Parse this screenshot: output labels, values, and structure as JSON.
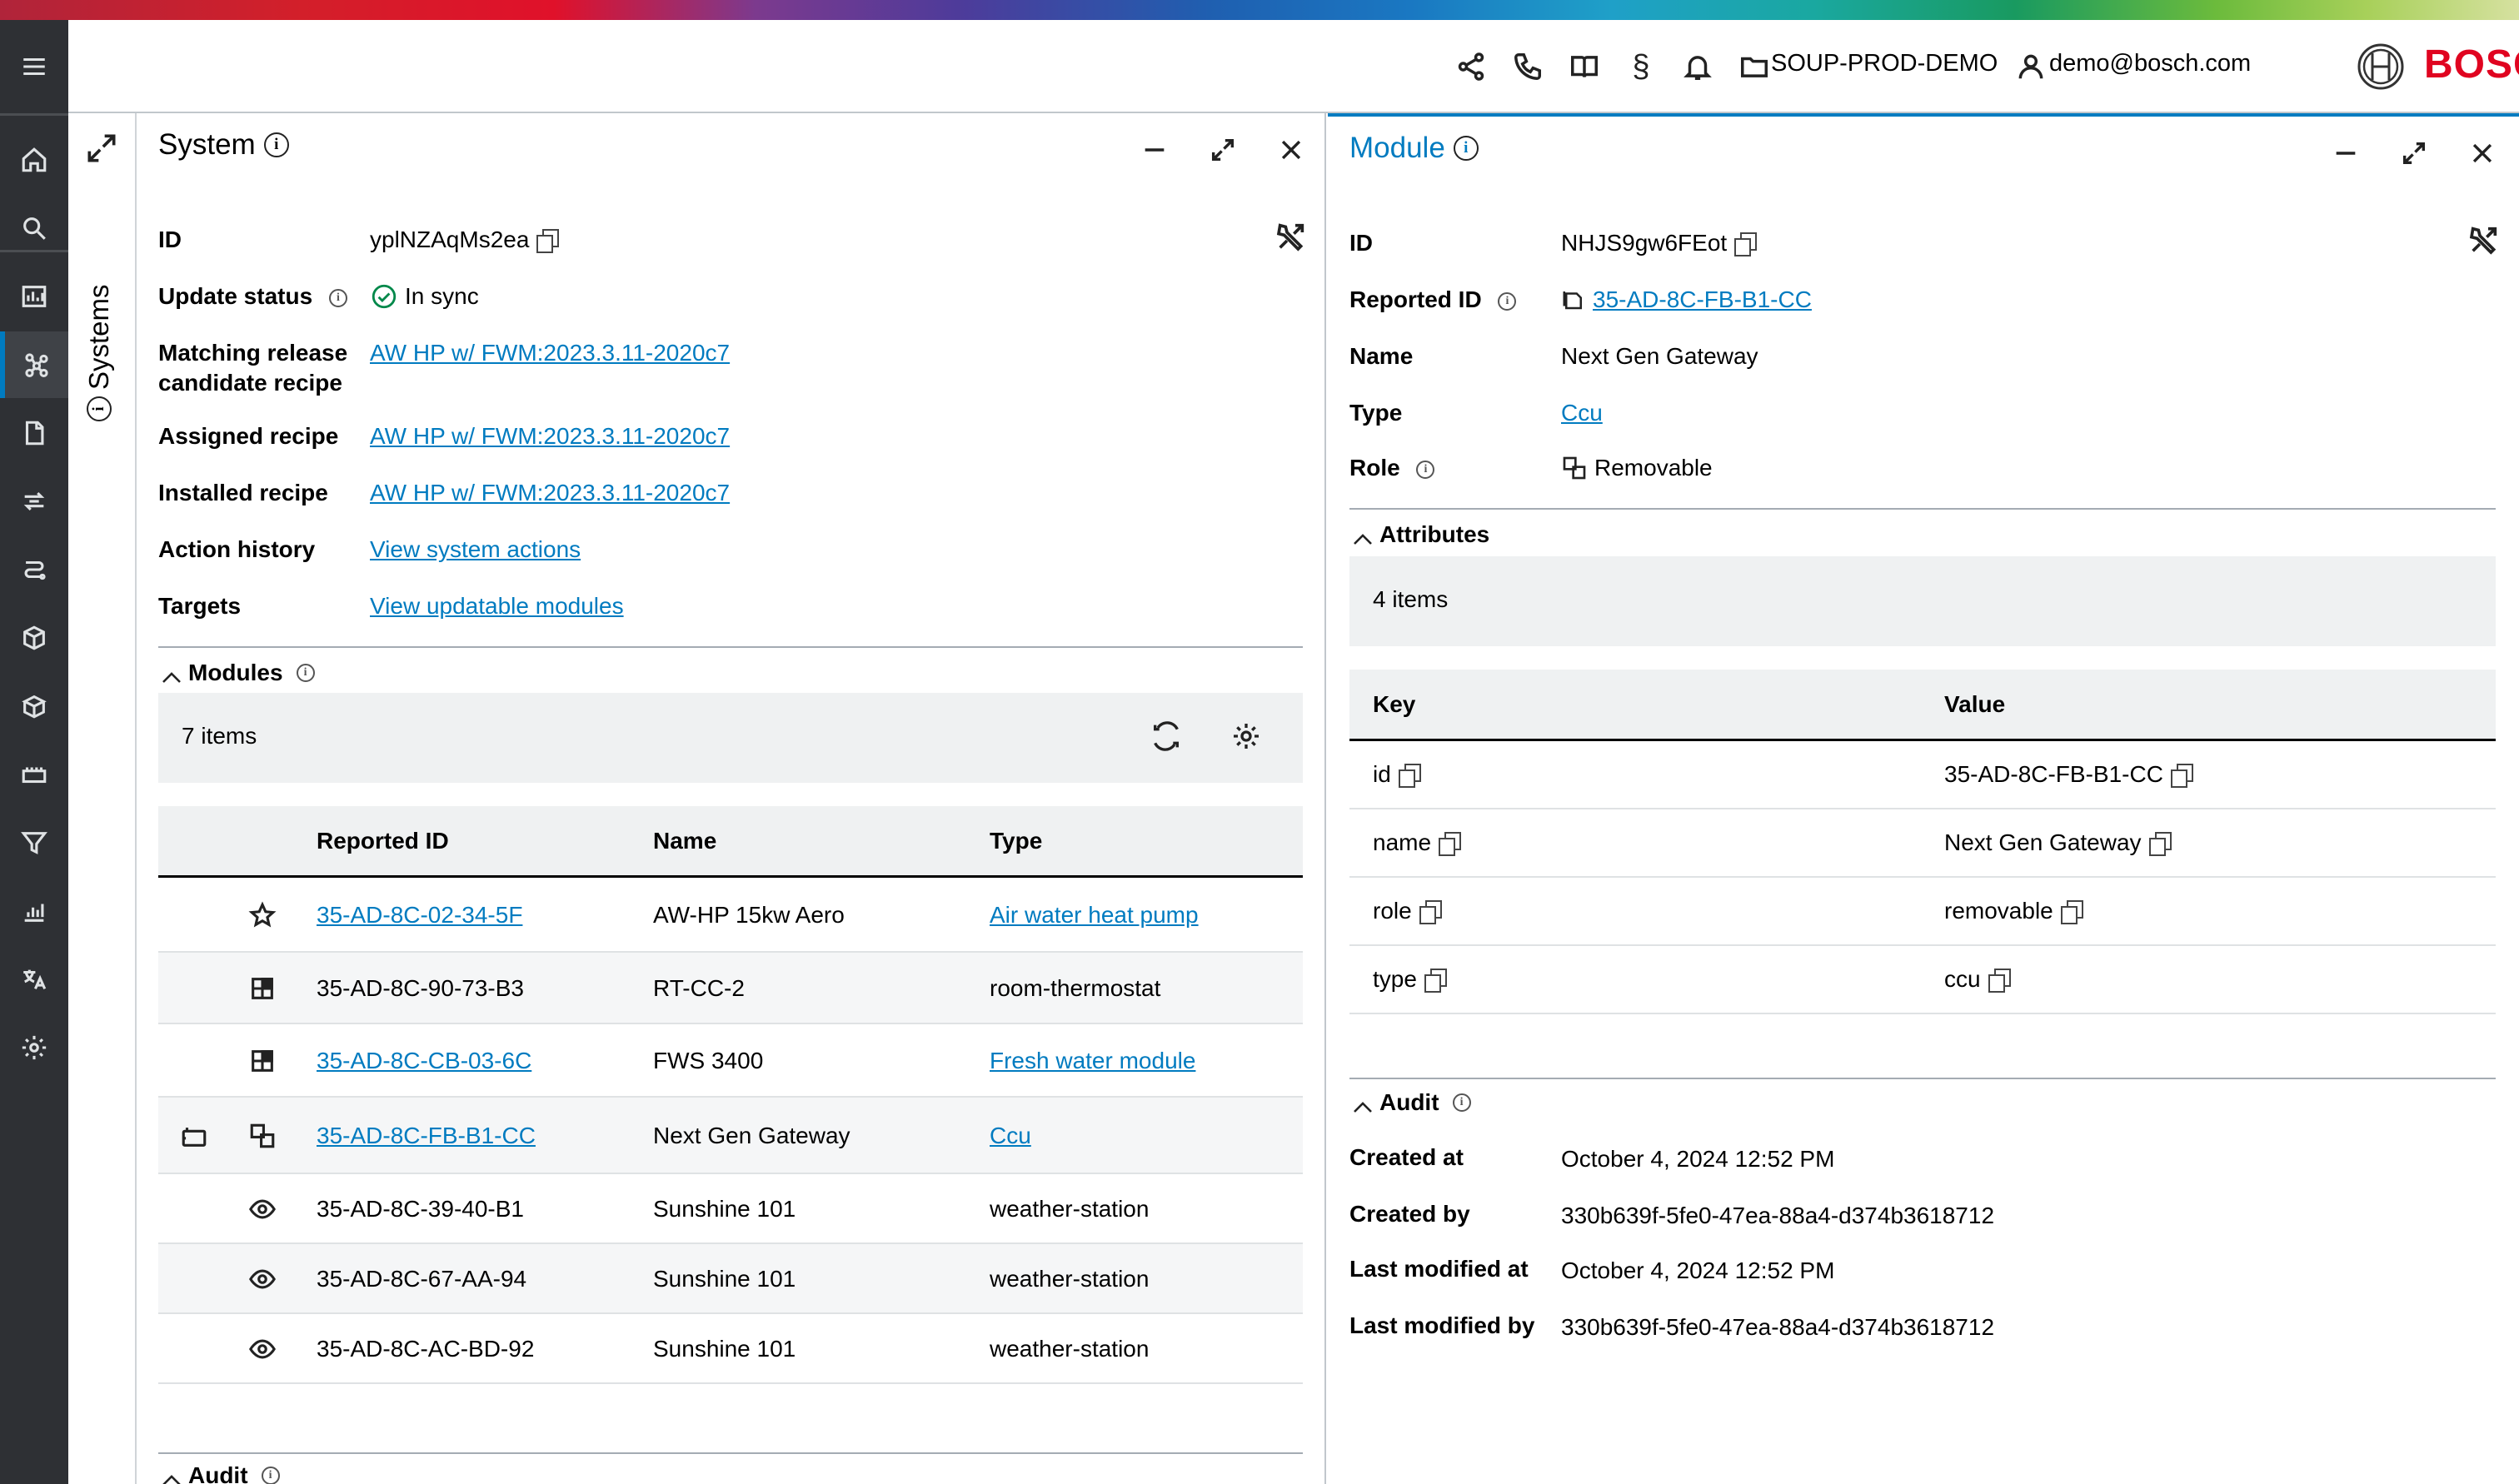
{
  "header": {
    "tenant": "SOUP-PROD-DEMO",
    "user": "demo@bosch.com",
    "brand": "BOSCH",
    "colors": {
      "accent": "#007bc0",
      "brand": "#e00420",
      "sidebar": "#2e3034"
    }
  },
  "sidebar": {
    "items": [
      {
        "icon": "menu-icon"
      },
      {
        "icon": "home-icon"
      },
      {
        "icon": "search-icon"
      },
      {
        "icon": "chart-board-icon"
      },
      {
        "icon": "network-icon"
      },
      {
        "icon": "document-icon"
      },
      {
        "icon": "swap-icon"
      },
      {
        "icon": "route-icon"
      },
      {
        "icon": "box-icon"
      },
      {
        "icon": "box-open-icon"
      },
      {
        "icon": "device-icon"
      },
      {
        "icon": "filter-icon"
      },
      {
        "icon": "bar-chart-icon"
      },
      {
        "icon": "translate-icon"
      },
      {
        "icon": "gear-icon"
      }
    ],
    "active": "network-icon"
  },
  "systems_tab": {
    "label": "Systems"
  },
  "system_panel": {
    "title": "System",
    "fields": {
      "id_label": "ID",
      "id_value": "yplNZAqMs2ea",
      "update_label": "Update status",
      "update_value": "In sync",
      "matching_label_1": "Matching release",
      "matching_label_2": "candidate recipe",
      "matching_value": "AW HP w/ FWM:2023.3.11-2020c7",
      "assigned_label": "Assigned recipe",
      "assigned_value": "AW HP w/ FWM:2023.3.11-2020c7",
      "installed_label": "Installed recipe",
      "installed_value": "AW HP w/ FWM:2023.3.11-2020c7",
      "action_label": "Action history",
      "action_value": "View system actions",
      "targets_label": "Targets",
      "targets_value": "View updatable modules"
    },
    "modules": {
      "heading": "Modules",
      "count": "7 items",
      "columns": [
        "Reported ID",
        "Name",
        "Type"
      ],
      "rows": [
        {
          "icon1": "",
          "icon2": "star-icon",
          "id": "35-AD-8C-02-34-5F",
          "id_link": true,
          "name": "AW-HP 15kw Aero",
          "type": "Air water heat pump",
          "type_link": true
        },
        {
          "icon1": "",
          "icon2": "module-grid-icon",
          "id": "35-AD-8C-90-73-B3",
          "id_link": false,
          "name": "RT-CC-2",
          "type": "room-thermostat",
          "type_link": false
        },
        {
          "icon1": "",
          "icon2": "module-grid-icon",
          "id": "35-AD-8C-CB-03-6C",
          "id_link": true,
          "name": "FWS 3400",
          "type": "Fresh water module",
          "type_link": true
        },
        {
          "icon1": "gateway-icon",
          "icon2": "removable-icon",
          "id": "35-AD-8C-FB-B1-CC",
          "id_link": true,
          "name": "Next Gen Gateway",
          "type": "Ccu",
          "type_link": true
        },
        {
          "icon1": "",
          "icon2": "eye-icon",
          "id": "35-AD-8C-39-40-B1",
          "id_link": false,
          "name": "Sunshine 101",
          "type": "weather-station",
          "type_link": false
        },
        {
          "icon1": "",
          "icon2": "eye-icon",
          "id": "35-AD-8C-67-AA-94",
          "id_link": false,
          "name": "Sunshine 101",
          "type": "weather-station",
          "type_link": false
        },
        {
          "icon1": "",
          "icon2": "eye-icon",
          "id": "35-AD-8C-AC-BD-92",
          "id_link": false,
          "name": "Sunshine 101",
          "type": "weather-station",
          "type_link": false
        }
      ]
    },
    "audit_heading": "Audit"
  },
  "module_panel": {
    "title": "Module",
    "fields": {
      "id_label": "ID",
      "id_value": "NHJS9gw6FEot",
      "reported_label": "Reported ID",
      "reported_value": "35-AD-8C-FB-B1-CC",
      "name_label": "Name",
      "name_value": "Next Gen Gateway",
      "type_label": "Type",
      "type_value": "Ccu",
      "role_label": "Role",
      "role_value": "Removable"
    },
    "attributes": {
      "heading": "Attributes",
      "count": "4 items",
      "columns": [
        "Key",
        "Value"
      ],
      "rows": [
        {
          "key": "id",
          "value": "35-AD-8C-FB-B1-CC"
        },
        {
          "key": "name",
          "value": "Next Gen Gateway"
        },
        {
          "key": "role",
          "value": "removable"
        },
        {
          "key": "type",
          "value": "ccu"
        }
      ]
    },
    "audit": {
      "heading": "Audit",
      "created_at_label": "Created at",
      "created_at": "October 4, 2024 12:52 PM",
      "created_by_label": "Created by",
      "created_by": "330b639f-5fe0-47ea-88a4-d374b3618712",
      "modified_at_label": "Last modified at",
      "modified_at": "October 4, 2024 12:52 PM",
      "modified_by_label": "Last modified by",
      "modified_by": "330b639f-5fe0-47ea-88a4-d374b3618712"
    }
  }
}
